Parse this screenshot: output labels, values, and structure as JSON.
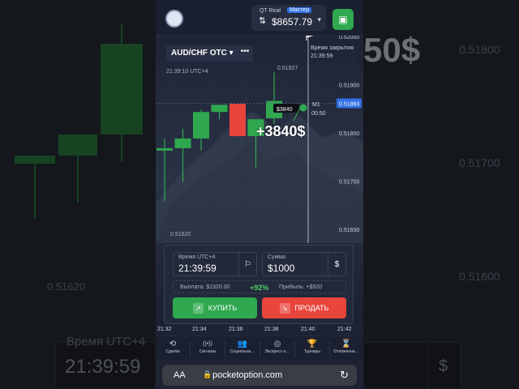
{
  "account": {
    "kind": "QT Real",
    "tag": "Мастер",
    "balance": "$8657.79"
  },
  "pair": "AUD/CHF OTC",
  "more_label": "•••",
  "clock": "21:39:10 UTC+4",
  "expiry": {
    "label": "Время закрытия",
    "time": "21:39:59",
    "timeframe": "M1",
    "countdown": "00:50"
  },
  "price_axis": [
    "0.52000",
    "0.51900",
    "0.51800",
    "0.51700",
    "0.51600"
  ],
  "current_price": "0.51863",
  "high_label": "0.51927",
  "low_label": "0.51620",
  "trade_badge": "$3840",
  "profit_overlay": "+3840$",
  "candles": [
    {
      "open": 0.51765,
      "close": 0.5177,
      "high": 0.5179,
      "low": 0.5166,
      "dir": "up"
    },
    {
      "open": 0.5177,
      "close": 0.5179,
      "high": 0.5181,
      "low": 0.517,
      "dir": "up"
    },
    {
      "open": 0.5179,
      "close": 0.51845,
      "high": 0.5185,
      "low": 0.51765,
      "dir": "up"
    },
    {
      "open": 0.51845,
      "close": 0.5186,
      "high": 0.5186,
      "low": 0.5183,
      "dir": "up"
    },
    {
      "open": 0.51862,
      "close": 0.51795,
      "high": 0.51862,
      "low": 0.51795,
      "dir": "down"
    },
    {
      "open": 0.51795,
      "close": 0.5183,
      "high": 0.5183,
      "low": 0.5173,
      "dir": "up"
    },
    {
      "open": 0.51832,
      "close": 0.51868,
      "high": 0.51927,
      "low": 0.5182,
      "dir": "up"
    }
  ],
  "order": {
    "time_label": "Время UTC+4",
    "time_value": "21:39:59",
    "amount_label": "Сумма",
    "amount_value": "$1000",
    "currency_symbol": "$",
    "payout_label": "Выплата: $1920.00",
    "payout_percent": "+92%",
    "profit_label": "Прибыль: +$920",
    "buy_label": "КУПИТЬ",
    "sell_label": "ПРОДАТЬ"
  },
  "time_axis": [
    "21:32",
    "21:34",
    "21:36",
    "21:38",
    "21:40",
    "21:42"
  ],
  "tabs": [
    {
      "icon": "history-icon",
      "glyph": "⟲",
      "label": "Сделки"
    },
    {
      "icon": "signals-icon",
      "glyph": "((•))",
      "label": "Сигналы"
    },
    {
      "icon": "social-icon",
      "glyph": "👥",
      "label": "Социальна…"
    },
    {
      "icon": "express-icon",
      "glyph": "◎",
      "label": "Экспресс-о…"
    },
    {
      "icon": "trophy-icon",
      "glyph": "🏆",
      "label": "Турниры"
    },
    {
      "icon": "hourglass-icon",
      "glyph": "⌛",
      "label": "Отложенна…"
    }
  ],
  "browser": {
    "text_size": "AA",
    "url": "pocketoption.com"
  },
  "background_blur": {
    "big_profit": "50$",
    "labels": [
      "0.51800",
      "0.51700",
      "0.51620",
      "0.51600",
      "Время UTC+4",
      "21:39:59",
      "$"
    ]
  },
  "colors": {
    "up": "#2fa84f",
    "down": "#e8453c",
    "accent": "#2f6fe3",
    "bg": "#1d2333"
  }
}
